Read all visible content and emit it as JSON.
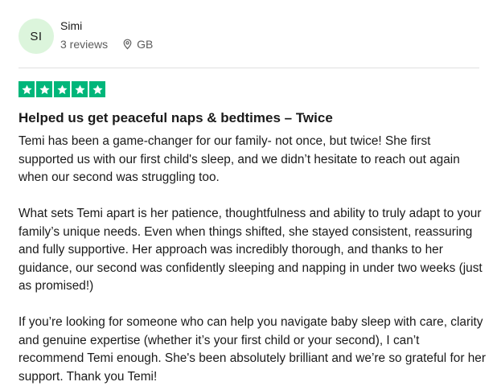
{
  "reviewer": {
    "initials": "SI",
    "name": "Simi",
    "reviews_count": "3 reviews",
    "location": "GB",
    "avatar_color": "#dcf5dc"
  },
  "rating": {
    "stars": 5,
    "max": 5,
    "star_color": "#00b67a"
  },
  "review": {
    "title": "Helped us get peaceful naps & bedtimes – Twice",
    "paragraphs": [
      "Temi has been a game-changer for our family- not once, but twice! She first supported us with our first child's sleep, and we didn’t hesitate to reach out again when our second was struggling too.",
      "What sets Temi apart is her patience, thoughtfulness and ability to truly adapt to your family’s unique needs. Even when things shifted, she stayed consistent, reassuring and fully supportive. Her approach was incredibly thorough, and thanks to her guidance, our second was confidently sleeping and napping in under two weeks (just as promised!)",
      "If you’re looking for someone who can help you navigate baby sleep with care, clarity and genuine expertise (whether it’s your first child or your second), I can’t recommend Temi enough. She's been absolutely brilliant and we’re so grateful for her support. Thank you Temi!"
    ]
  }
}
